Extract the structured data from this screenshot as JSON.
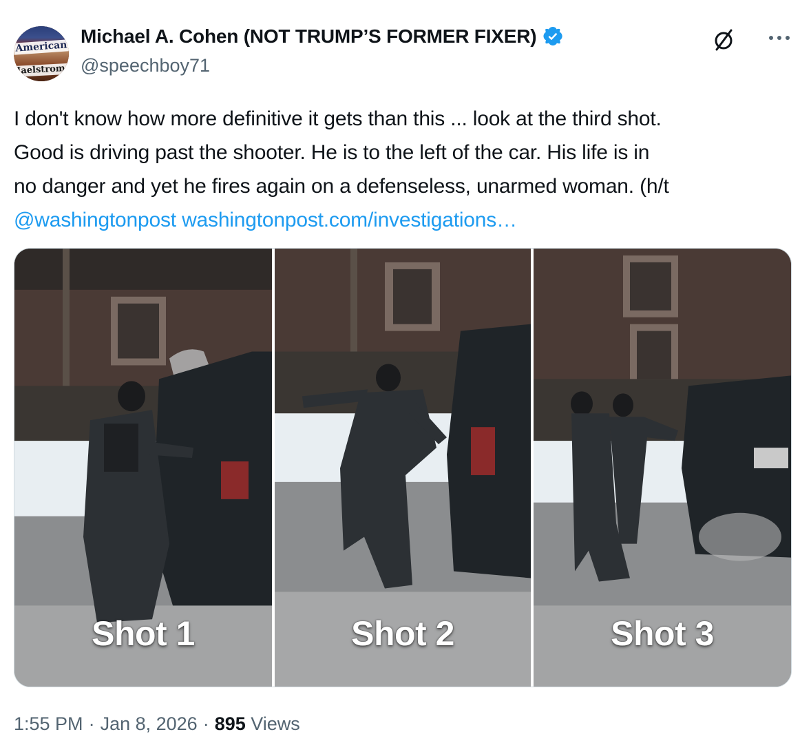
{
  "author": {
    "display_name": "Michael A. Cohen (NOT TRUMP’S FORMER FIXER)",
    "handle": "@speechboy71",
    "avatar_text_top": "American",
    "avatar_text_bottom": "Maelstrom",
    "verified": true,
    "verified_color": "#1d9bf0"
  },
  "icons": {
    "grok": "grok-icon",
    "more": "more-options-icon"
  },
  "tweet": {
    "lines": [
      "I don't know how more definitive it gets than this ... look at the third shot.",
      "Good is driving past the shooter. He is to the left of the car. His life is in",
      "no danger and yet he fires again on a defenseless, unarmed woman. (h/t"
    ],
    "mention": "@washingtonpost",
    "url": "washingtonpost.com/investigations…",
    "link_color": "#1d9bf0"
  },
  "media": {
    "panels": [
      {
        "label": "Shot 1"
      },
      {
        "label": "Shot 2"
      },
      {
        "label": "Shot 3"
      }
    ]
  },
  "footer": {
    "time": "1:55 PM",
    "date": "Jan 8, 2026",
    "separator": "·",
    "views_count": "895",
    "views_label": "Views"
  }
}
